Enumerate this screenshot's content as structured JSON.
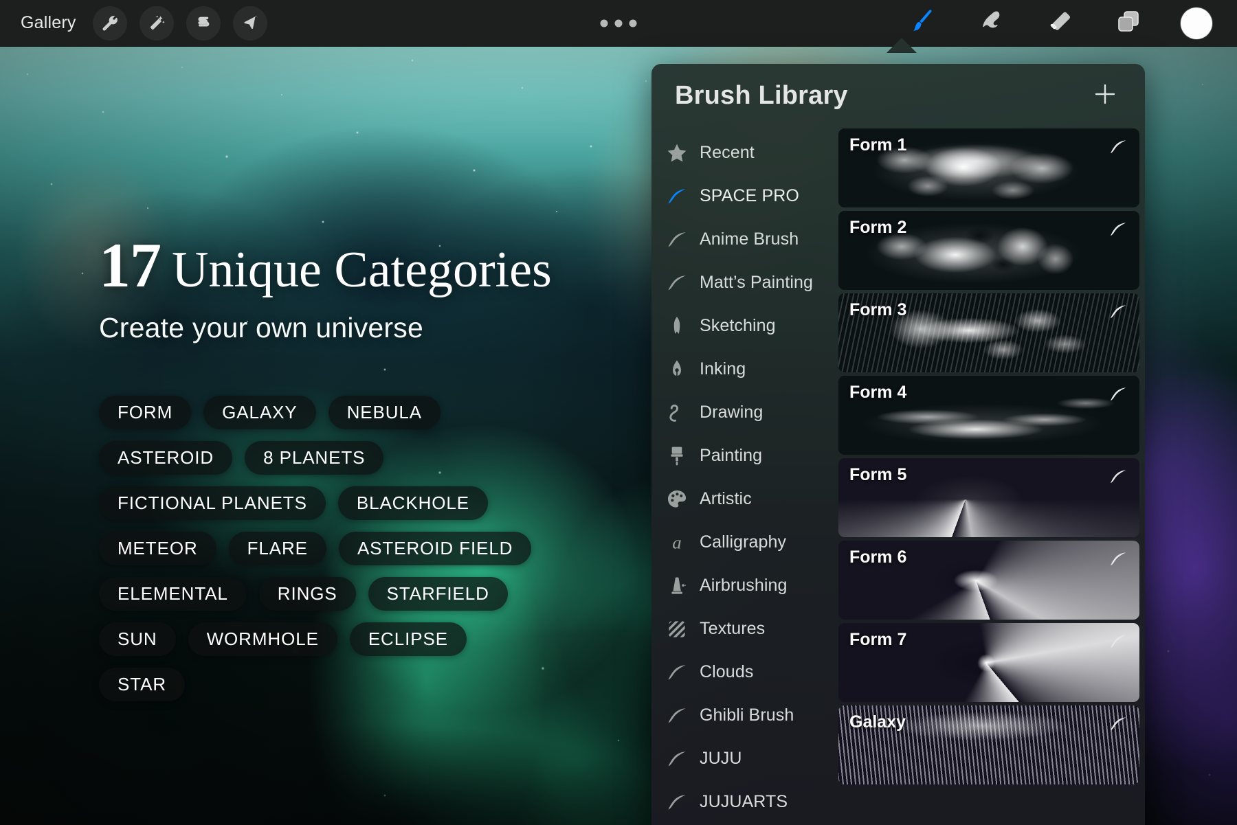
{
  "toolbar": {
    "gallery_label": "Gallery",
    "left_tools": [
      {
        "name": "wrench-icon",
        "label": "Actions"
      },
      {
        "name": "magic-wand-icon",
        "label": "Adjustments"
      },
      {
        "name": "selection-icon",
        "label": "Selection"
      },
      {
        "name": "transform-arrow-icon",
        "label": "Transform"
      }
    ],
    "menu_dots_label": "•••",
    "right_tools": [
      {
        "name": "paintbrush-icon",
        "label": "Paint",
        "active": true,
        "color": "#0a84ff"
      },
      {
        "name": "smudge-icon",
        "label": "Smudge",
        "active": false,
        "color": "#c8c8c8"
      },
      {
        "name": "eraser-icon",
        "label": "Erase",
        "active": false,
        "color": "#c8c8c8"
      },
      {
        "name": "layers-icon",
        "label": "Layers",
        "active": false,
        "color": "#c8c8c8"
      }
    ],
    "color_swatch": {
      "label": "Color",
      "hex": "#fdfdfd"
    }
  },
  "hero": {
    "count": "17",
    "title": "Unique Categories",
    "subtitle": "Create your own universe"
  },
  "categories_rows": [
    [
      "FORM",
      "GALAXY",
      "NEBULA"
    ],
    [
      "ASTEROID",
      "8 PLANETS"
    ],
    [
      "FICTIONAL PLANETS",
      "BLACKHOLE"
    ],
    [
      "METEOR",
      "FLARE",
      "ASTEROID FIELD"
    ],
    [
      "ELEMENTAL",
      "RINGS",
      "STARFIELD"
    ],
    [
      "SUN",
      "WORMHOLE",
      "ECLIPSE"
    ],
    [
      "STAR"
    ]
  ],
  "brush_library": {
    "title": "Brush Library",
    "add_button_label": "+",
    "sets": [
      {
        "label": "Recent",
        "icon": "star-icon",
        "active": false
      },
      {
        "label": "SPACE PRO",
        "icon": "brush-stroke-icon",
        "active": true
      },
      {
        "label": "Anime Brush",
        "icon": "brush-stroke-icon",
        "active": false
      },
      {
        "label": "Matt’s Painting",
        "icon": "brush-stroke-icon",
        "active": false
      },
      {
        "label": "Sketching",
        "icon": "pencil-icon",
        "active": false
      },
      {
        "label": "Inking",
        "icon": "ink-pen-icon",
        "active": false
      },
      {
        "label": "Drawing",
        "icon": "squiggle-icon",
        "active": false
      },
      {
        "label": "Painting",
        "icon": "paint-brush-icon",
        "active": false
      },
      {
        "label": "Artistic",
        "icon": "palette-icon",
        "active": false
      },
      {
        "label": "Calligraphy",
        "icon": "letter-a-icon",
        "active": false
      },
      {
        "label": "Airbrushing",
        "icon": "airbrush-icon",
        "active": false
      },
      {
        "label": "Textures",
        "icon": "hatch-square-icon",
        "active": false
      },
      {
        "label": "Clouds",
        "icon": "brush-stroke-icon",
        "active": false
      },
      {
        "label": "Ghibli Brush",
        "icon": "brush-stroke-icon",
        "active": false
      },
      {
        "label": "JUJU",
        "icon": "brush-stroke-icon",
        "active": false
      },
      {
        "label": "JUJUARTS",
        "icon": "brush-stroke-icon",
        "active": false
      }
    ],
    "brushes": [
      {
        "name": "Form 1",
        "preview": "nebula-burst",
        "badge": "brush-stroke-icon"
      },
      {
        "name": "Form 2",
        "preview": "nebula-cloud",
        "badge": "brush-stroke-icon"
      },
      {
        "name": "Form 3",
        "preview": "swirl-streaks",
        "badge": "brush-stroke-icon"
      },
      {
        "name": "Form 4",
        "preview": "wispy-clouds",
        "badge": "brush-stroke-icon"
      },
      {
        "name": "Form 5",
        "preview": "vortex-swirl",
        "badge": "brush-stroke-icon"
      },
      {
        "name": "Form 6",
        "preview": "spiral-galaxy",
        "badge": "brush-stroke-icon"
      },
      {
        "name": "Form 7",
        "preview": "galaxy-core",
        "badge": "brush-stroke-icon"
      },
      {
        "name": "Galaxy",
        "preview": "galaxy-streaks",
        "badge": "brush-stroke-icon"
      }
    ]
  }
}
